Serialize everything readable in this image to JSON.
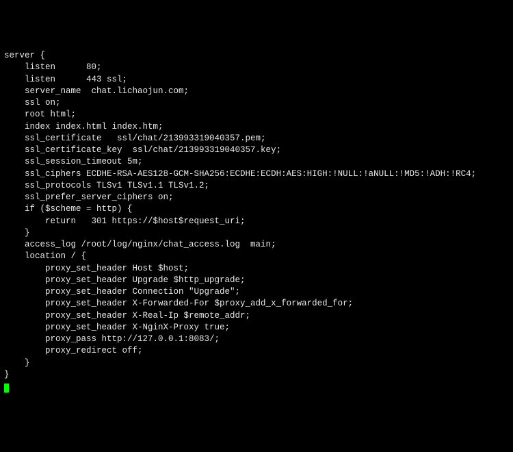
{
  "lines": [
    "server {",
    "    listen      80;",
    "    listen      443 ssl;",
    "",
    "    server_name  chat.lichaojun.com;",
    "",
    "    ssl on;",
    "    root html;",
    "    index index.html index.htm;",
    "    ssl_certificate   ssl/chat/213993319040357.pem;",
    "    ssl_certificate_key  ssl/chat/213993319040357.key;",
    "    ssl_session_timeout 5m;",
    "    ssl_ciphers ECDHE-RSA-AES128-GCM-SHA256:ECDHE:ECDH:AES:HIGH:!NULL:!aNULL:!MD5:!ADH:!RC4;",
    "    ssl_protocols TLSv1 TLSv1.1 TLSv1.2;",
    "    ssl_prefer_server_ciphers on;",
    "",
    "    if ($scheme = http) {",
    "        return   301 https://$host$request_uri;",
    "    }",
    "",
    "    access_log /root/log/nginx/chat_access.log  main;",
    "",
    "    location / {",
    "        proxy_set_header Host $host;",
    "        proxy_set_header Upgrade $http_upgrade;",
    "        proxy_set_header Connection \"Upgrade\";",
    "        proxy_set_header X-Forwarded-For $proxy_add_x_forwarded_for;",
    "        proxy_set_header X-Real-Ip $remote_addr;",
    "        proxy_set_header X-NginX-Proxy true;",
    "        proxy_pass http://127.0.0.1:8083/;",
    "        proxy_redirect off;",
    "    }",
    "}"
  ],
  "cursor_char": "]"
}
